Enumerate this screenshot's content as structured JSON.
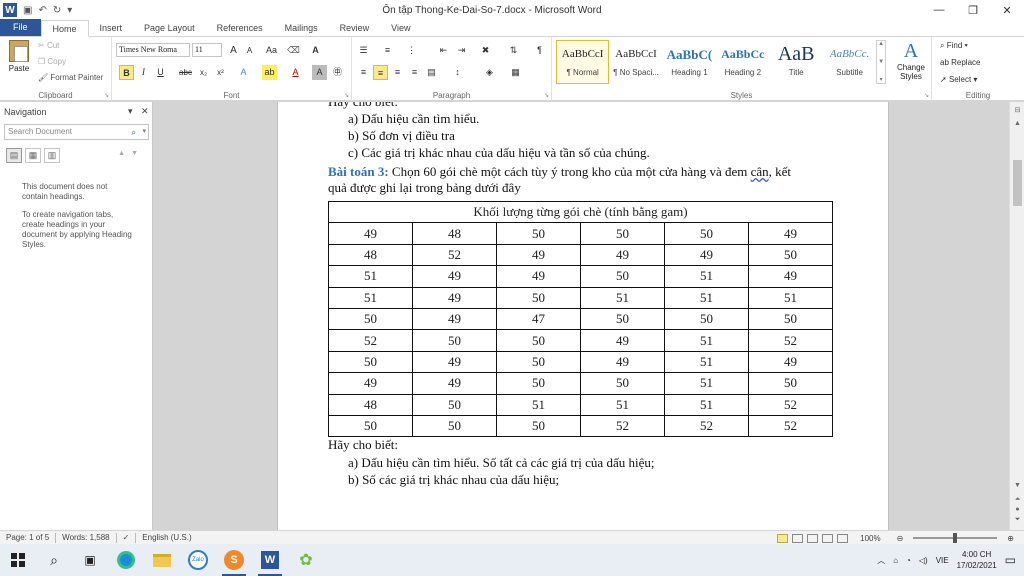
{
  "titlebar": {
    "title": "Ôn tập Thong-Ke-Dai-So-7.docx - Microsoft Word",
    "app_icon": "W",
    "minimize": "—",
    "restore": "❐",
    "close": "✕"
  },
  "tabs": [
    "File",
    "Home",
    "Insert",
    "Page Layout",
    "References",
    "Mailings",
    "Review",
    "View"
  ],
  "ribbon": {
    "clipboard": {
      "label": "Clipboard",
      "paste": "Paste",
      "cut": "Cut",
      "copy": "Copy",
      "format_painter": "Format Painter"
    },
    "font": {
      "label": "Font",
      "family": "Times New Roma",
      "size": "11",
      "grow": "A",
      "shrink": "A",
      "case": "Aa",
      "bold": "B",
      "italic": "I",
      "underline": "U",
      "strike": "abc",
      "subscript": "x₂",
      "superscript": "x²"
    },
    "paragraph": {
      "label": "Paragraph"
    },
    "styles": {
      "label": "Styles",
      "items": [
        {
          "sample": "AaBbCcI",
          "name": "¶ Normal"
        },
        {
          "sample": "AaBbCcI",
          "name": "¶ No Spaci..."
        },
        {
          "sample": "AaBbC(",
          "name": "Heading 1"
        },
        {
          "sample": "AaBbCc",
          "name": "Heading 2"
        },
        {
          "sample": "AaB",
          "name": "Title"
        },
        {
          "sample": "AaBbCc.",
          "name": "Subtitle"
        }
      ],
      "change_styles": "Change Styles"
    },
    "editing": {
      "label": "Editing",
      "find": "Find",
      "replace": "Replace",
      "select": "Select"
    }
  },
  "nav": {
    "title": "Navigation",
    "search_placeholder": "Search Document",
    "msg1": "This document does not contain headings.",
    "msg2": "To create navigation tabs, create headings in your document by applying Heading Styles."
  },
  "document": {
    "cut_line": "Hãy cho biết:",
    "list1": [
      "a)  Dấu hiệu cần tìm hiểu.",
      "b)  Số đơn vị điều tra",
      "c)  Các giá trị khác nhau của dấu hiệu và tần số của chúng."
    ],
    "problem_label": "Bài toán 3:",
    "problem_text_1": " Chọn 60 gói chè một cách tùy ý trong kho của một cửa hàng và đem ",
    "problem_text_squiggle": "cân",
    "problem_text_2": ", kết",
    "problem_line2": "quả được ghi lại trong bảng dưới đây",
    "table_header": "Khối lượng từng gói chè (tính bằng gam)",
    "table_rows": [
      [
        49,
        48,
        50,
        50,
        50,
        49
      ],
      [
        48,
        52,
        49,
        49,
        49,
        50
      ],
      [
        51,
        49,
        49,
        50,
        51,
        49
      ],
      [
        51,
        49,
        50,
        51,
        51,
        51
      ],
      [
        50,
        49,
        47,
        50,
        50,
        50
      ],
      [
        52,
        50,
        50,
        49,
        51,
        52
      ],
      [
        50,
        49,
        50,
        49,
        51,
        49
      ],
      [
        49,
        49,
        50,
        50,
        51,
        50
      ],
      [
        48,
        50,
        51,
        51,
        51,
        52
      ],
      [
        50,
        50,
        50,
        52,
        52,
        52
      ]
    ],
    "after_table": "Hãy cho biết:",
    "list2": [
      "a)  Dấu hiệu cần tìm hiểu. Số tất cả các giá trị của dấu hiệu;",
      "b)  Số các giá trị khác nhau của dấu hiệu;"
    ]
  },
  "status": {
    "page": "Page: 1 of 5",
    "words": "Words: 1,588",
    "language": "English (U.S.)",
    "zoom": "100%"
  },
  "taskbar": {
    "lang": "VIE",
    "time": "4:00 CH",
    "date": "17/02/2021",
    "zalo": "Zalo"
  }
}
